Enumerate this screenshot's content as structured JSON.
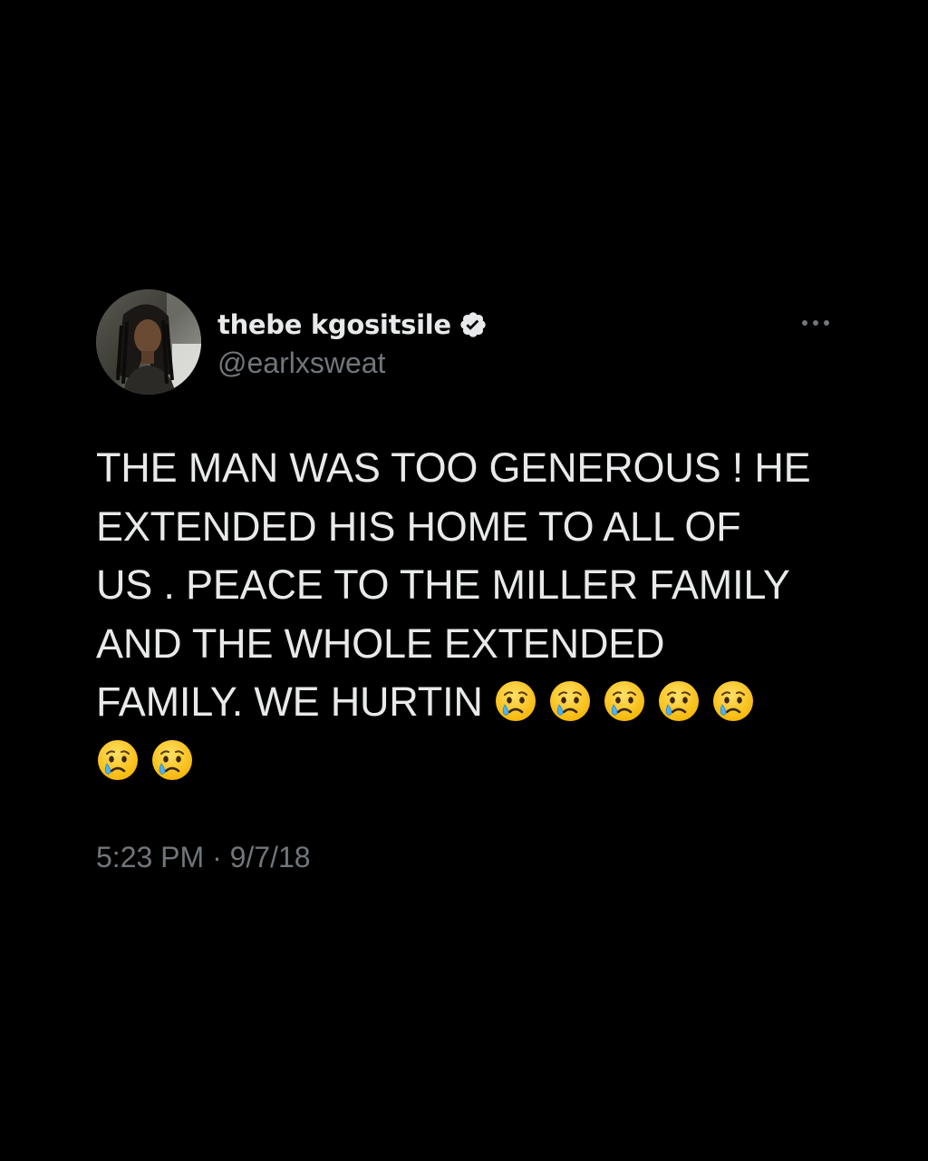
{
  "colors": {
    "background": "#000000",
    "text_primary": "#e7e9ea",
    "text_secondary": "#71767b",
    "verified_badge": "#e7e9ea"
  },
  "tweet": {
    "author": {
      "display_name": "thebe kgositsile",
      "handle": "@earlxsweat",
      "verified": true,
      "avatar_icon": "profile-photo"
    },
    "more_icon": "more-options-icon",
    "text_lines": [
      "THE MAN WAS TOO GENEROUS ! HE",
      "EXTENDED HIS HOME TO ALL OF",
      "US . PEACE TO THE MILLER FAMILY",
      "AND THE WHOLE EXTENDED",
      "FAMILY. WE HURTIN "
    ],
    "emoji_name": "crying-face-emoji",
    "emoji_count_line5": 5,
    "emoji_count_line6": 2,
    "timestamp": "5:23 PM · 9/7/18"
  }
}
